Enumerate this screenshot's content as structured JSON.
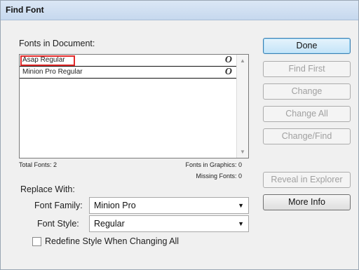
{
  "window": {
    "title": "Find Font"
  },
  "fonts_section": {
    "label": "Fonts in Document:",
    "fonts": [
      {
        "name": "Asap Regular",
        "type_icon": "opentype-icon",
        "type_glyph": "O",
        "selected": true
      },
      {
        "name": "Minion Pro Regular",
        "type_icon": "opentype-icon",
        "type_glyph": "O",
        "selected": false
      }
    ],
    "total_fonts": "Total Fonts: 2",
    "fonts_in_graphics": "Fonts in Graphics: 0",
    "missing_fonts": "Missing Fonts: 0"
  },
  "replace_with": {
    "label": "Replace With:",
    "font_family_label": "Font Family:",
    "font_family_value": "Minion Pro",
    "font_style_label": "Font Style:",
    "font_style_value": "Regular",
    "redefine_label": "Redefine Style When Changing All",
    "redefine_checked": false
  },
  "buttons": {
    "done": "Done",
    "find_first": "Find First",
    "change": "Change",
    "change_all": "Change All",
    "change_find": "Change/Find",
    "reveal": "Reveal in Explorer",
    "more_info": "More Info"
  },
  "colors": {
    "selection_outline": "#e22b2b",
    "title_bar": "#c6d8ee",
    "default_button": "#c4e4f8"
  }
}
